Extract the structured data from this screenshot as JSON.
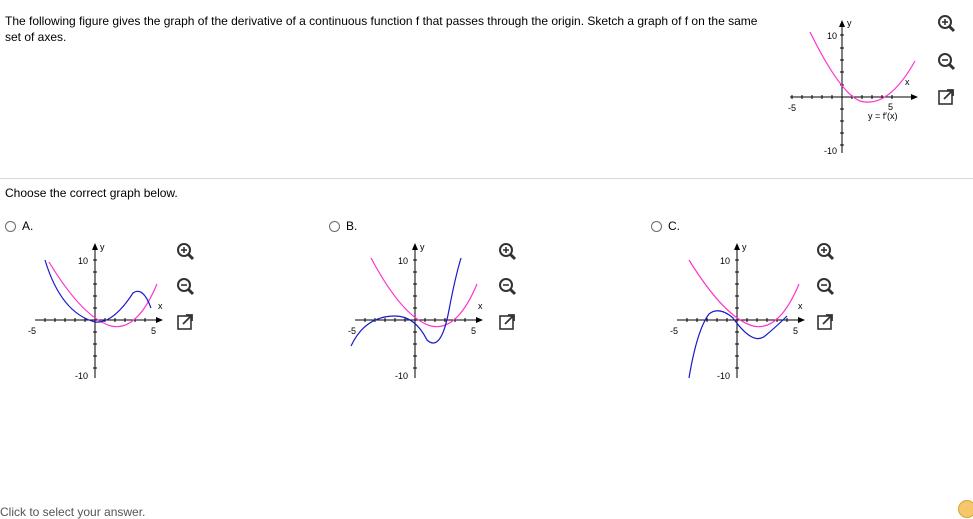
{
  "question": {
    "text": "The following figure gives the graph of the derivative of a continuous function f that passes through the origin. Sketch a graph of f on the same set of axes."
  },
  "main_graph": {
    "y_axis_label": "y",
    "x_axis_label": "x",
    "y_top_tick": "10",
    "y_bottom_tick": "-10",
    "x_left_tick": "-5",
    "x_right_tick": "5",
    "curve_label": "y = f′(x)"
  },
  "prompt": {
    "text": "Choose the correct graph below."
  },
  "options": [
    {
      "letter": "A.",
      "y_axis_label": "y",
      "x_axis_label": "x",
      "y_top_tick": "10",
      "y_bottom_tick": "-10",
      "x_left_tick": "-5",
      "x_right_tick": "5"
    },
    {
      "letter": "B.",
      "y_axis_label": "y",
      "x_axis_label": "x",
      "y_top_tick": "10",
      "y_bottom_tick": "-10",
      "x_left_tick": "-5",
      "x_right_tick": "5"
    },
    {
      "letter": "C.",
      "y_axis_label": "y",
      "x_axis_label": "x",
      "y_top_tick": "10",
      "y_bottom_tick": "-10",
      "x_left_tick": "-5",
      "x_right_tick": "5"
    }
  ],
  "colors": {
    "derivative_curve": "#ff33cc",
    "candidate_curve": "#1a1acc",
    "axis": "#000000",
    "radio_border": "#6b6b6b"
  },
  "icons": [
    "zoom-in-icon",
    "zoom-out-icon",
    "popout-icon"
  ],
  "footer": {
    "text": "Click to select your answer."
  }
}
